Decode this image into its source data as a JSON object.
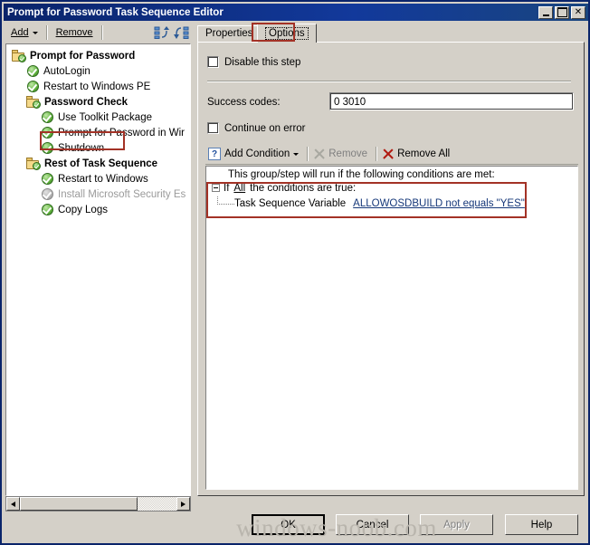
{
  "window": {
    "title": "Prompt for Password Task Sequence Editor",
    "controls": [
      {
        "name": "minimize-button",
        "label": "_"
      },
      {
        "name": "maximize-button",
        "label": "□"
      },
      {
        "name": "close-button",
        "label": "✕"
      }
    ]
  },
  "toolbar": {
    "add_label": "Add",
    "remove_label": "Remove",
    "icons": [
      "move-up-icon",
      "move-down-icon"
    ]
  },
  "tree": {
    "items": [
      {
        "label": "Prompt for Password",
        "icon": "folder-check-icon",
        "indent": 0,
        "group": true,
        "disabled": false,
        "highlighted": false
      },
      {
        "label": "AutoLogin",
        "icon": "green-check-icon",
        "indent": 1,
        "group": false,
        "disabled": false,
        "highlighted": false
      },
      {
        "label": "Restart to Windows PE",
        "icon": "green-check-icon",
        "indent": 1,
        "group": false,
        "disabled": false,
        "highlighted": false
      },
      {
        "label": "Password Check",
        "icon": "folder-check-icon",
        "indent": 1,
        "group": true,
        "disabled": false,
        "highlighted": false
      },
      {
        "label": "Use Toolkit Package",
        "icon": "green-check-icon",
        "indent": 2,
        "group": false,
        "disabled": false,
        "highlighted": false
      },
      {
        "label": "Prompt for Password in Wir",
        "icon": "green-check-icon",
        "indent": 2,
        "group": false,
        "disabled": false,
        "highlighted": false
      },
      {
        "label": "Shutdown",
        "icon": "green-check-icon",
        "indent": 2,
        "group": false,
        "disabled": false,
        "highlighted": true
      },
      {
        "label": "Rest of Task Sequence",
        "icon": "folder-check-icon",
        "indent": 1,
        "group": true,
        "disabled": false,
        "highlighted": false
      },
      {
        "label": "Restart to Windows",
        "icon": "green-check-icon",
        "indent": 2,
        "group": false,
        "disabled": false,
        "highlighted": false
      },
      {
        "label": "Install Microsoft Security Es",
        "icon": "gray-check-icon",
        "indent": 2,
        "group": false,
        "disabled": true,
        "highlighted": false
      },
      {
        "label": "Copy Logs",
        "icon": "green-check-icon",
        "indent": 2,
        "group": false,
        "disabled": false,
        "highlighted": false
      }
    ],
    "scrollbar": {
      "left_arrow": "◄",
      "right_arrow": "►"
    }
  },
  "tabs": [
    {
      "label": "Properties",
      "selected": false
    },
    {
      "label": "Options",
      "selected": true
    }
  ],
  "options_pane": {
    "disable_step": {
      "label": "Disable this step",
      "checked": false
    },
    "success_codes": {
      "label": "Success codes:",
      "value": "0 3010",
      "placeholder": ""
    },
    "continue_on_error": {
      "label": "Continue on error",
      "checked": false
    },
    "condition_toolbar": {
      "add_condition": "Add Condition",
      "remove": "Remove",
      "remove_all": "Remove All",
      "remove_enabled": false
    },
    "conditions": {
      "header": "This group/step will run if the following conditions are met:",
      "if_prefix": "If",
      "if_scope": "All",
      "if_suffix": "the conditions are true:",
      "rows": [
        {
          "type_label": "Task Sequence Variable",
          "value": "ALLOWOSDBUILD not equals \"YES\""
        }
      ]
    }
  },
  "footer": {
    "buttons": [
      {
        "label": "OK",
        "name": "ok-button",
        "default": true,
        "disabled": false
      },
      {
        "label": "Cancel",
        "name": "cancel-button",
        "default": false,
        "disabled": false
      },
      {
        "label": "Apply",
        "name": "apply-button",
        "default": false,
        "disabled": true
      },
      {
        "label": "Help",
        "name": "help-button",
        "default": false,
        "disabled": false
      }
    ]
  },
  "watermark": "windows-noob.com",
  "colors": {
    "titlebar": "#0a246a",
    "face": "#d4d0c8",
    "annotation": "#a33226",
    "link": "#16387a"
  }
}
